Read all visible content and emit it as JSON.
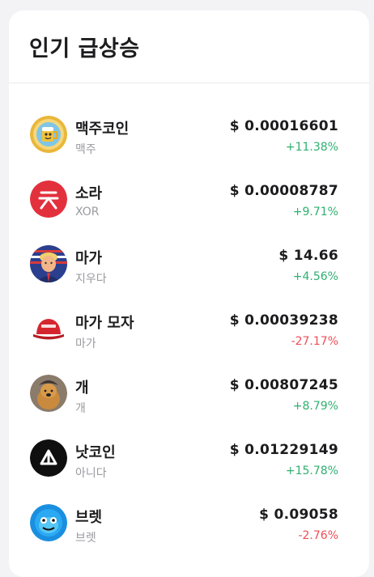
{
  "panel": {
    "title": "인기 급상승"
  },
  "colors": {
    "positive": "#2fb06f",
    "negative": "#ef4d56"
  },
  "coins": [
    {
      "name": "맥주코인",
      "symbol": "맥주",
      "price": "$ 0.00016601",
      "change": "+11.38%",
      "direction": "up",
      "icon": "beer-coin-logo-icon"
    },
    {
      "name": "소라",
      "symbol": "XOR",
      "price": "$ 0.00008787",
      "change": "+9.71%",
      "direction": "up",
      "icon": "sora-logo-icon"
    },
    {
      "name": "마가",
      "symbol": "지우다",
      "price": "$ 14.66",
      "change": "+4.56%",
      "direction": "up",
      "icon": "maga-portrait-icon"
    },
    {
      "name": "마가 모자",
      "symbol": "마가",
      "price": "$ 0.00039238",
      "change": "-27.17%",
      "direction": "down",
      "icon": "red-hat-icon"
    },
    {
      "name": "개",
      "symbol": "개",
      "price": "$ 0.00807245",
      "change": "+8.79%",
      "direction": "up",
      "icon": "dog-icon"
    },
    {
      "name": "낫코인",
      "symbol": "아니다",
      "price": "$ 0.01229149",
      "change": "+15.78%",
      "direction": "up",
      "icon": "notcoin-logo-icon"
    },
    {
      "name": "브렛",
      "symbol": "브렛",
      "price": "$ 0.09058",
      "change": "-2.76%",
      "direction": "down",
      "icon": "brett-logo-icon"
    }
  ]
}
